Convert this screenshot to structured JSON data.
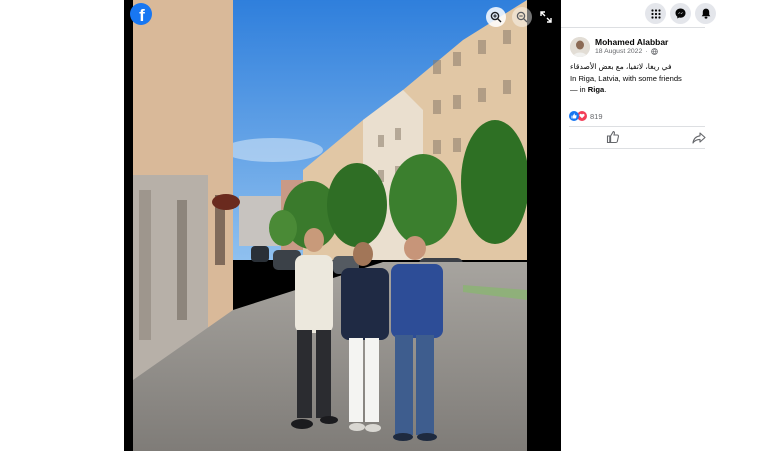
{
  "viewer": {
    "brand_icon": "facebook-icon",
    "controls": [
      "zoom-in-icon",
      "zoom-out-icon",
      "fullscreen-icon"
    ],
    "photo": {
      "subject": "three men standing on a cobblestone street lined with buildings and trees",
      "colors": {
        "sky": "#3f8ce0",
        "street": "#8f8c88",
        "building": "#d8bfa0"
      }
    }
  },
  "topbar": {
    "buttons": [
      "grid-menu-icon",
      "messenger-icon",
      "notifications-icon"
    ]
  },
  "post": {
    "author": "Mohamed Alabbar",
    "date": "18 August 2022",
    "privacy_icon": "globe-icon",
    "text_arabic": "في ريغا، لاتفيا، مع بعض الأصدقاء",
    "text_english": "In Riga, Latvia, with some friends",
    "location_prefix": "— in ",
    "location": "Riga",
    "location_suffix": ".",
    "reactions": {
      "count": "819",
      "types": [
        "like-icon",
        "love-icon"
      ]
    },
    "actions": [
      "like-button",
      "share-button"
    ]
  },
  "colors": {
    "brand": "#1877f2",
    "love": "#f33e58",
    "text": "#050505",
    "muted": "#65676b"
  }
}
